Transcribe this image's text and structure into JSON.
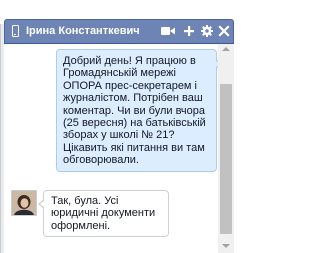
{
  "chat": {
    "contact_name": "Ірина Константкевич",
    "icons": {
      "mobile": "mobile-phone-icon",
      "video": "video-camera-icon",
      "add": "add-friend-icon",
      "settings": "gear-icon",
      "close": "close-icon"
    },
    "colors": {
      "titlebar": "#6d84b4",
      "outgoing_bubble": "#dbedfe",
      "incoming_bubble": "#ffffff"
    }
  },
  "messages": [
    {
      "direction": "outgoing",
      "text": "Добрий день! Я працюю в Громадянській мережі ОПОРА прес-секретарем і журналістом. Потрібен ваш коментар. Чи ви були вчора (25 вересня) на батьківській зборах у школі № 21? Цікавить які питання ви там обговорювали."
    },
    {
      "direction": "incoming",
      "text": "Так, була. Усі юридичні документи оформлені."
    }
  ]
}
